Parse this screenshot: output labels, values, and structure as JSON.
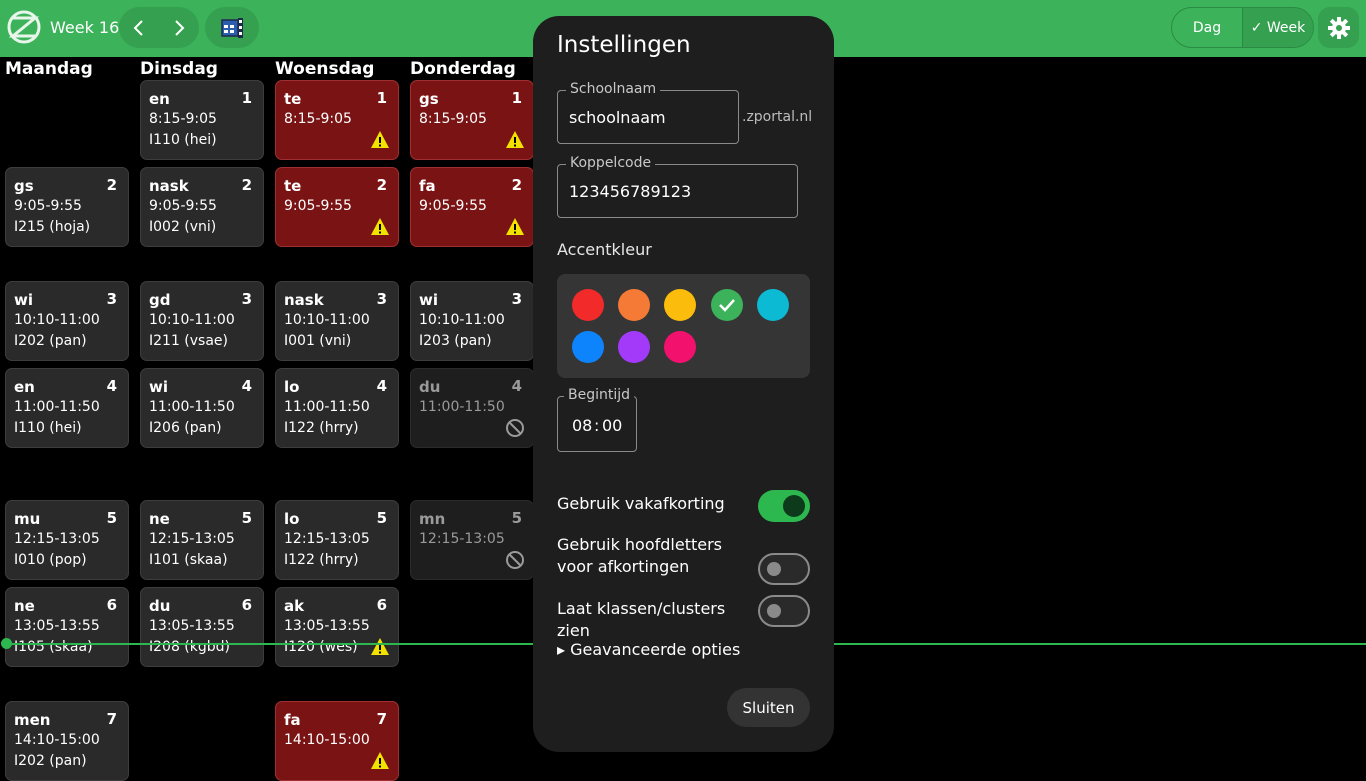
{
  "header": {
    "week_label": "Week 16",
    "view_day": "Dag",
    "view_week": "✓ Week",
    "accent": "#3cb35a"
  },
  "days": [
    "Maandag",
    "Dinsdag",
    "Woensdag",
    "Donderdag"
  ],
  "lessons": [
    {
      "subject": "en",
      "num": "1",
      "time": "8:15-9:05",
      "room": "I110 (hei)"
    },
    {
      "subject": "te",
      "num": "1",
      "time": "8:15-9:05",
      "room": "",
      "badge": "warning-icon"
    },
    {
      "subject": "gs",
      "num": "1",
      "time": "8:15-9:05",
      "room": "",
      "badge": "warning-icon"
    },
    {
      "subject": "gs",
      "num": "2",
      "time": "9:05-9:55",
      "room": "I215 (hoja)"
    },
    {
      "subject": "nask",
      "num": "2",
      "time": "9:05-9:55",
      "room": "I002 (vni)"
    },
    {
      "subject": "te",
      "num": "2",
      "time": "9:05-9:55",
      "room": "",
      "badge": "warning-icon"
    },
    {
      "subject": "fa",
      "num": "2",
      "time": "9:05-9:55",
      "room": "",
      "badge": "warning-icon"
    },
    {
      "subject": "wi",
      "num": "3",
      "time": "10:10-11:00",
      "room": "I202 (pan)"
    },
    {
      "subject": "gd",
      "num": "3",
      "time": "10:10-11:00",
      "room": "I211 (vsae)"
    },
    {
      "subject": "nask",
      "num": "3",
      "time": "10:10-11:00",
      "room": "I001 (vni)"
    },
    {
      "subject": "wi",
      "num": "3",
      "time": "10:10-11:00",
      "room": "I203 (pan)"
    },
    {
      "subject": "en",
      "num": "4",
      "time": "11:00-11:50",
      "room": "I110 (hei)"
    },
    {
      "subject": "wi",
      "num": "4",
      "time": "11:00-11:50",
      "room": "I206 (pan)"
    },
    {
      "subject": "lo",
      "num": "4",
      "time": "11:00-11:50",
      "room": "I122 (hrry)"
    },
    {
      "subject": "du",
      "num": "4",
      "time": "11:00-11:50",
      "room": "",
      "badge": "cancelled-icon"
    },
    {
      "subject": "mu",
      "num": "5",
      "time": "12:15-13:05",
      "room": "I010 (pop)"
    },
    {
      "subject": "ne",
      "num": "5",
      "time": "12:15-13:05",
      "room": "I101 (skaa)"
    },
    {
      "subject": "lo",
      "num": "5",
      "time": "12:15-13:05",
      "room": "I122 (hrry)"
    },
    {
      "subject": "mn",
      "num": "5",
      "time": "12:15-13:05",
      "room": "",
      "badge": "cancelled-icon"
    },
    {
      "subject": "ne",
      "num": "6",
      "time": "13:05-13:55",
      "room": "I105 (skaa)"
    },
    {
      "subject": "du",
      "num": "6",
      "time": "13:05-13:55",
      "room": "I208 (kgbd)"
    },
    {
      "subject": "ak",
      "num": "6",
      "time": "13:05-13:55",
      "room": "I120 (wes)",
      "badge": "warning-icon"
    },
    {
      "subject": "men",
      "num": "7",
      "time": "14:10-15:00",
      "room": "I202 (pan)"
    },
    {
      "subject": "fa",
      "num": "7",
      "time": "14:10-15:00",
      "room": "",
      "badge": "warning-icon"
    }
  ],
  "settings": {
    "title": "Instellingen",
    "school_label": "Schoolnaam",
    "school_value": "schoolnaam",
    "school_suffix": ".zportal.nl",
    "code_label": "Koppelcode",
    "code_value": "123456789123",
    "accent_label": "Accentkleur",
    "colors": [
      "#f22a2a",
      "#f47a35",
      "#fcbc0b",
      "#3cb35a",
      "#0cbad4",
      "#0d84fc",
      "#a33af9",
      "#f2116d"
    ],
    "selected_color": "#3cb35a",
    "start_label": "Begintijd",
    "start_hour": "08",
    "start_sep": ":",
    "start_minute": "00",
    "toggle1_label": "Gebruik vakafkorting",
    "toggle1_on": true,
    "toggle2_label": "Gebruik hoofdletters voor afkortingen",
    "toggle2_on": false,
    "toggle3_label": "Laat klassen/clusters zien",
    "toggle3_on": false,
    "advanced_label": "▸ Geavanceerde opties",
    "close_label": "Sluiten"
  }
}
